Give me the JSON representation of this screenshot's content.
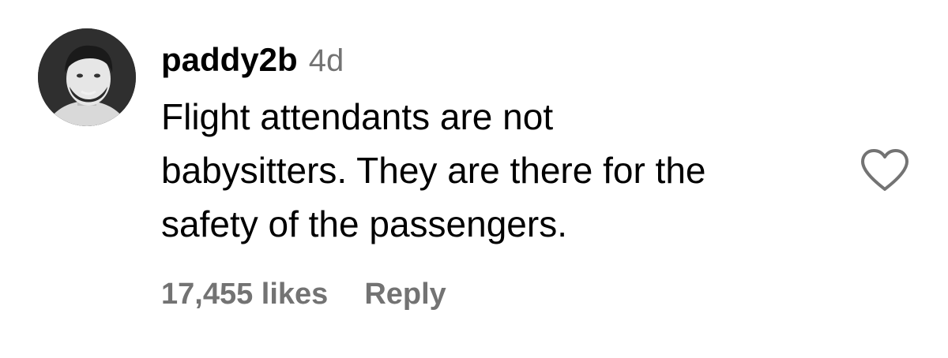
{
  "comment": {
    "username": "paddy2b",
    "timestamp": "4d",
    "text_lines": [
      "Flight attendants are not",
      "babysitters. They are there for the",
      "safety of the passengers."
    ],
    "likes": "17,455 likes",
    "reply_label": "Reply",
    "avatar_icon": "user-avatar-photo",
    "like_icon": "heart-outline-icon"
  },
  "colors": {
    "primary_text": "#000000",
    "secondary_text": "#737373",
    "background": "#ffffff"
  }
}
